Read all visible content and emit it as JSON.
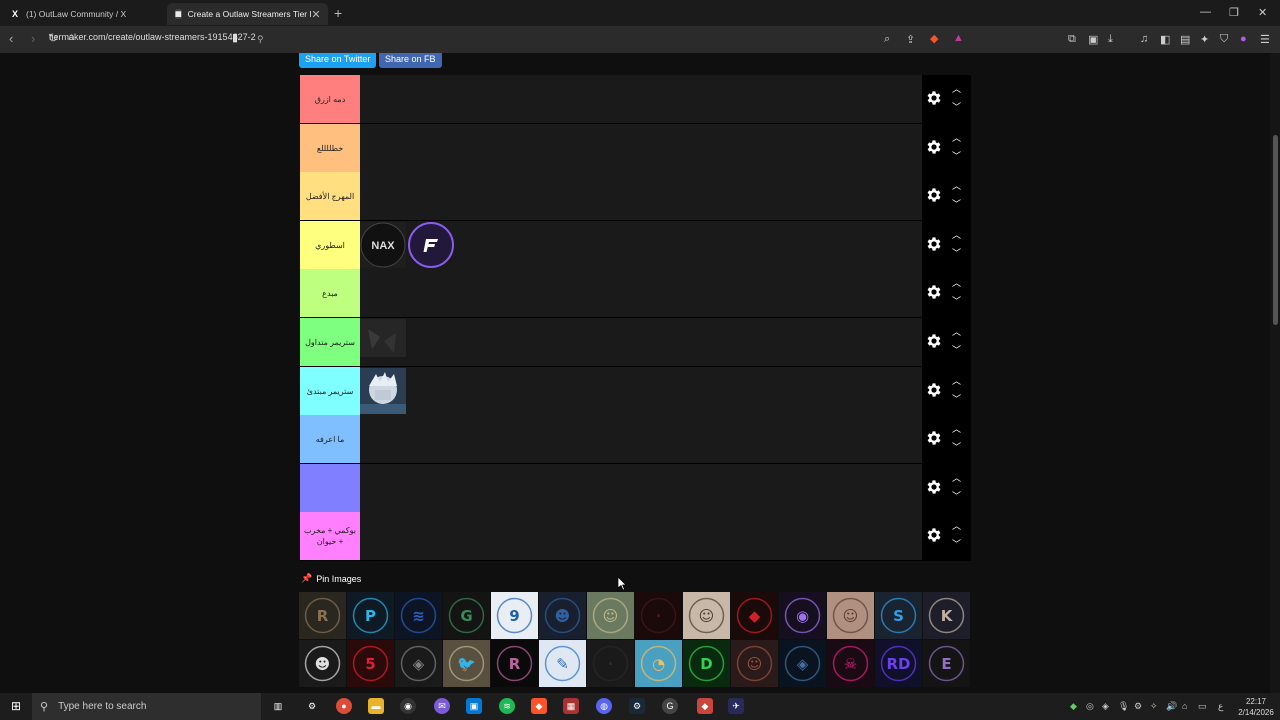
{
  "browser": {
    "tabs": [
      {
        "title": "(1) OutLaw Community / X",
        "favicon": "x-logo-icon"
      },
      {
        "title": "Create a Outlaw Streamers Tier l",
        "favicon": "tiermaker-icon",
        "active": true
      }
    ],
    "url": "tiermaker.com/create/outlaw-streamers-19154627-2"
  },
  "share": {
    "twitter_label": "Share on Twitter",
    "facebook_label": "Share on FB"
  },
  "tiers": [
    {
      "label": "دمه ازرق",
      "color": "#ff7f7f"
    },
    {
      "label": "خطللللع",
      "color": "#ffbf7f"
    },
    {
      "label": "المهرج الأفضل",
      "color": "#ffdf7f"
    },
    {
      "label": "اسطوري",
      "color": "#ffff7f"
    },
    {
      "label": "مبدع",
      "color": "#bfff7f"
    },
    {
      "label": "ستريمر متداول",
      "color": "#7fff7f"
    },
    {
      "label": "ستريمر مبتدئ",
      "color": "#7fffff"
    },
    {
      "label": "ما اعرفه",
      "color": "#7fbfff"
    },
    {
      "label": "",
      "color": "#7f7fff"
    },
    {
      "label": "بوكمي + مخرب + حيوان",
      "color": "#ff7fff"
    }
  ],
  "pin_images_label": "Pin Images",
  "taskbar": {
    "search_placeholder": "Type here to search",
    "time": "22:17",
    "date": "2/14/2026",
    "language": "ع"
  },
  "colors": {
    "page_bg": "#0f0f0f",
    "tier_row_bg": "#1a1a1a",
    "twitter_blue": "#1da1f2",
    "facebook_blue": "#4267b2"
  }
}
